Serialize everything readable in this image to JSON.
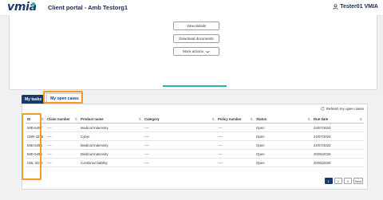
{
  "header": {
    "logo_text": "vmia",
    "portal_title": "Client portal - Amb Testorg1",
    "user_name": "Tester01 VMIA"
  },
  "actions_panel": {
    "top_text": "",
    "view_details": "View details",
    "download_documents": "Download documents",
    "more_actions": "More actions"
  },
  "tabs": [
    {
      "label": "My tasks"
    },
    {
      "label": "My open cases"
    }
  ],
  "refresh_label": "Refresh my open cases",
  "table": {
    "columns": [
      "ID",
      "Claim number",
      "Product name",
      "Category",
      "Policy number",
      "Status",
      "Due date"
    ],
    "rows": [
      {
        "id": "MID-5497",
        "claim": "----",
        "product": "Medical Indemnity",
        "category": "----",
        "policy": "----",
        "status": "Open",
        "due": "24/07/2024"
      },
      {
        "id": "CBR-3219",
        "claim": "----",
        "product": "Cyber",
        "category": "----",
        "policy": "----",
        "status": "Open",
        "due": "24/07/2024"
      },
      {
        "id": "MID-5496",
        "claim": "----",
        "product": "Medical Indemnity",
        "category": "----",
        "policy": "----",
        "status": "Open",
        "due": "24/07/2024"
      },
      {
        "id": "MID-5495",
        "claim": "----",
        "product": "Medical Indemnity",
        "category": "----",
        "policy": "----",
        "status": "Open",
        "due": "20/06/2025"
      },
      {
        "id": "CBL-3340",
        "claim": "----",
        "product": "Combined liability",
        "category": "----",
        "policy": "----",
        "status": "Open",
        "due": "20/06/2025"
      }
    ]
  },
  "pagination": {
    "pages": [
      "1",
      "2",
      "3"
    ],
    "next": "Next"
  },
  "colors": {
    "brand_navy": "#1a3a6e",
    "accent_teal": "#2bb3a3",
    "highlight_orange": "#f59a23"
  }
}
